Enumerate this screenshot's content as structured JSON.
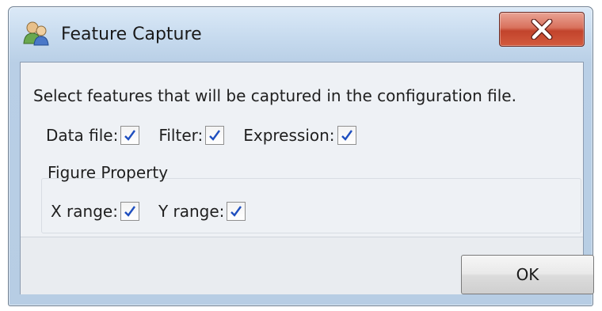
{
  "window": {
    "title": "Feature Capture"
  },
  "title_icon": "users-icon",
  "close_icon": "close-icon",
  "instruction": "Select features that will be captured in the configuration file.",
  "features": [
    {
      "label": "Data file:",
      "checked": true
    },
    {
      "label": "Filter:",
      "checked": true
    },
    {
      "label": "Expression:",
      "checked": true
    }
  ],
  "figure_property": {
    "title": "Figure Property",
    "items": [
      {
        "label": "X range:",
        "checked": true
      },
      {
        "label": "Y range:",
        "checked": true
      }
    ]
  },
  "footer": {
    "ok_label": "OK"
  },
  "colors": {
    "checkmark": "#1f4fbf",
    "close_button": "#c2432c"
  }
}
